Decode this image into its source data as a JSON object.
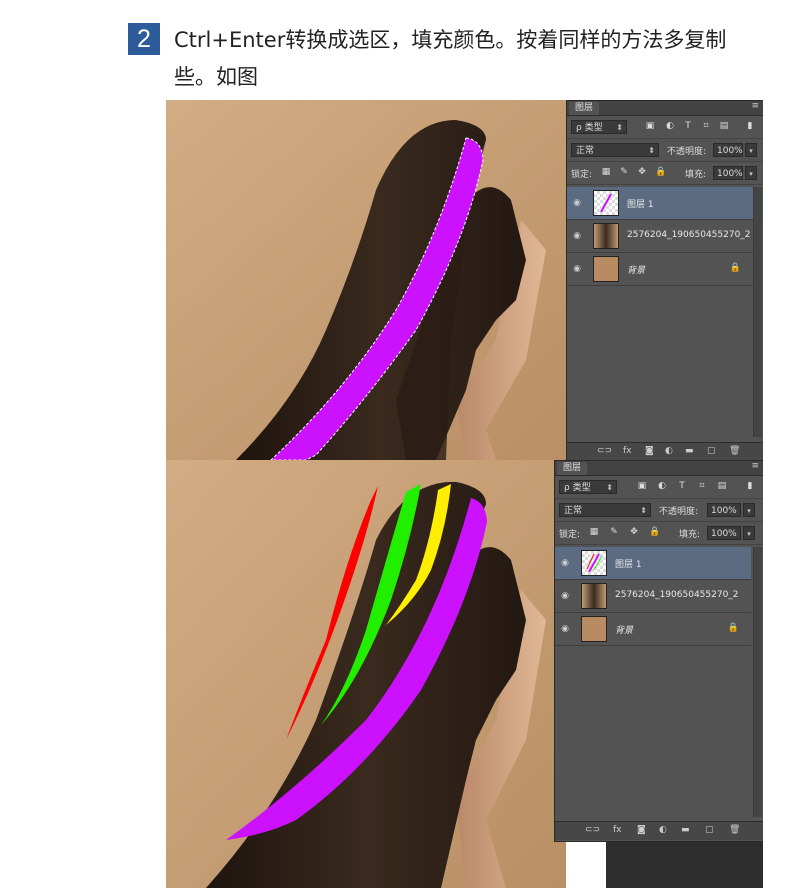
{
  "step": {
    "number": "2",
    "text": "Ctrl+Enter转换成选区，填充颜色。按着同样的方法多复制些。如图"
  },
  "panel1": {
    "tab": "图层",
    "menu_icon": "≡",
    "filter_label": "ρ 类型",
    "blend_mode": "正常",
    "opacity_label": "不透明度:",
    "opacity_value": "100%",
    "lock_label": "锁定:",
    "fill_label": "填充:",
    "fill_value": "100%",
    "layers": [
      {
        "name": "图层 1",
        "active": true
      },
      {
        "name": "2576204_190650455270_2",
        "active": false
      },
      {
        "name": "背景",
        "active": false,
        "locked": true
      }
    ]
  },
  "panel2": {
    "tab": "图层",
    "menu_icon": "≡",
    "filter_label": "ρ 类型",
    "blend_mode": "正常",
    "opacity_label": "不透明度:",
    "opacity_value": "100%",
    "lock_label": "锁定:",
    "fill_label": "填充:",
    "fill_value": "100%",
    "layers": [
      {
        "name": "图层 1",
        "active": true
      },
      {
        "name": "2576204_190650455270_2",
        "active": false
      },
      {
        "name": "背景",
        "active": false,
        "locked": true
      }
    ]
  },
  "footer_icons": [
    "link-icon",
    "fx-icon",
    "mask-icon",
    "adjustment-icon",
    "folder-icon",
    "new-layer-icon",
    "trash-icon"
  ],
  "colors": {
    "badge": "#2e5c9a",
    "panel_bg": "#535353",
    "active_layer": "#5a6b82",
    "stripe_purple": "#cc11ff",
    "stripe_red": "#ff0000",
    "stripe_green": "#22ee00",
    "stripe_yellow": "#ffee00",
    "photo_bg": "#c9a37c"
  }
}
